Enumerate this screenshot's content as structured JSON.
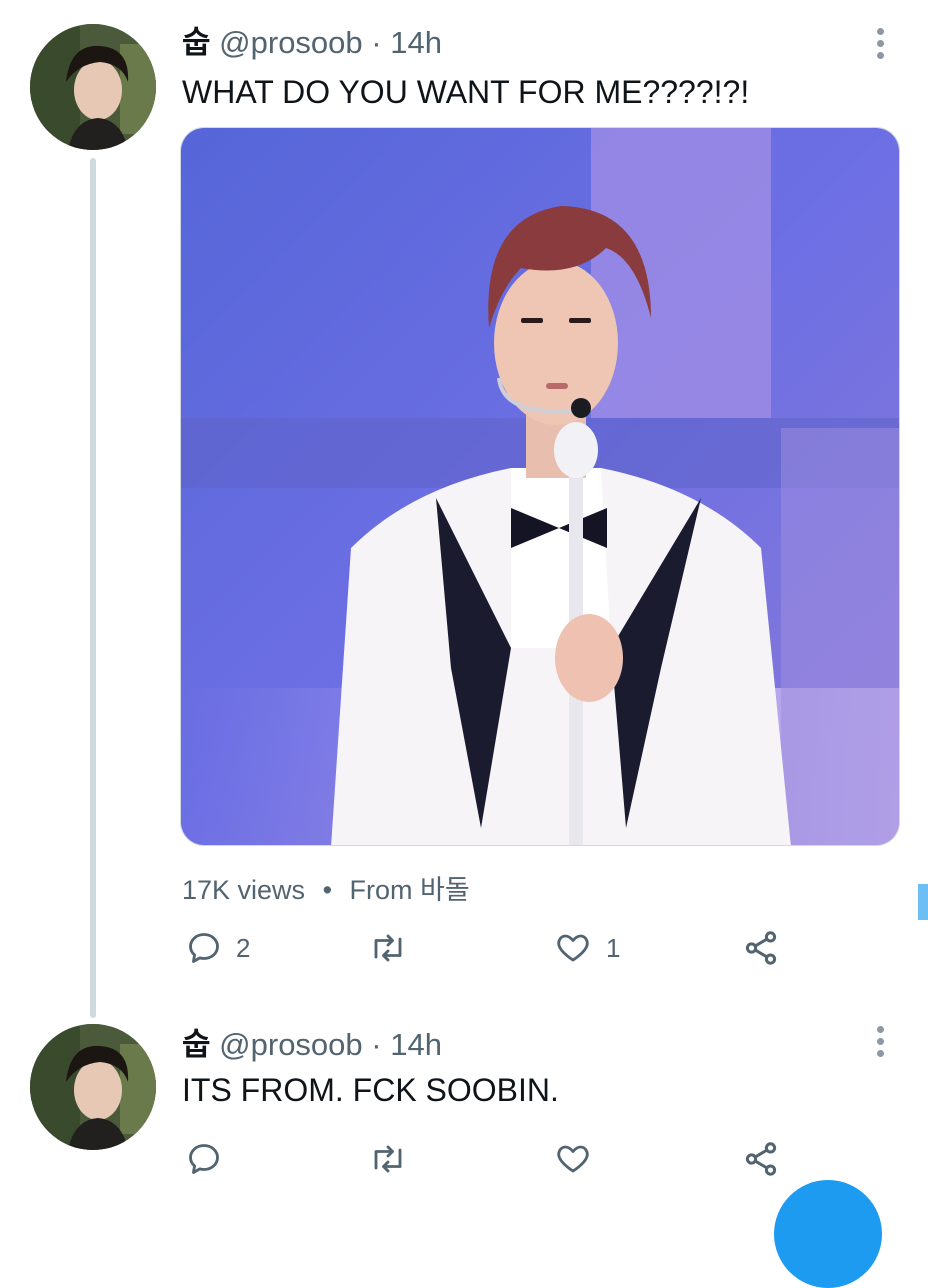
{
  "colors": {
    "accent": "#1d9bf0",
    "text_primary": "#0f1419",
    "text_secondary": "#536471",
    "thread_line": "#cfd9de"
  },
  "tweets": [
    {
      "author_name": "숩",
      "handle": "@prosoob",
      "separator": "·",
      "time": "14h",
      "text": "WHAT DO YOU WANT FOR ME????!?!",
      "media": {
        "icon": "photo",
        "description_visible": false
      },
      "views": "17K views",
      "meta_separator": "•",
      "source": "From 바돌",
      "actions": {
        "reply_count": "2",
        "retweet_count": "",
        "like_count": "1"
      }
    },
    {
      "author_name": "숩",
      "handle": "@prosoob",
      "separator": "·",
      "time": "14h",
      "text": "ITS FROM. FCK SOOBIN.",
      "actions": {
        "reply_count": "",
        "retweet_count": "",
        "like_count": ""
      }
    }
  ],
  "icons": {
    "more": "more-vertical-icon",
    "reply": "reply-icon",
    "retweet": "retweet-icon",
    "like": "heart-icon",
    "share": "share-icon",
    "compose": "compose-fab"
  }
}
